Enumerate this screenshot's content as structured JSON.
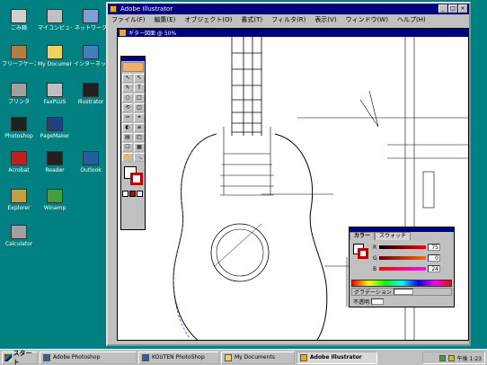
{
  "desktop": {
    "icons": [
      {
        "label": "ごみ箱",
        "icon": "recycle-bin-icon",
        "color": "#d0d0d0"
      },
      {
        "label": "マイコンピュータ",
        "icon": "my-computer-icon",
        "color": "#c0c0c0"
      },
      {
        "label": "ネットワーク",
        "icon": "network-icon",
        "color": "#7fa0d0"
      },
      {
        "label": "ブリーフケース",
        "icon": "briefcase-icon",
        "color": "#b08040"
      },
      {
        "label": "My Documents",
        "icon": "folder-icon",
        "color": "#f0d060"
      },
      {
        "label": "インターネット",
        "icon": "internet-icon",
        "color": "#4080c0"
      },
      {
        "label": "プリンタ",
        "icon": "printer-icon",
        "color": "#a0a0a0"
      },
      {
        "label": "FaxPLUS",
        "icon": "fax-icon",
        "color": "#c0c0c0"
      },
      {
        "label": "Illustrator",
        "icon": "illustrator-icon",
        "color": "#202020"
      },
      {
        "label": "Photoshop",
        "icon": "photoshop-icon",
        "color": "#202020"
      },
      {
        "label": "PageMaker",
        "icon": "pagemaker-icon",
        "color": "#204080"
      },
      {
        "label": "Acrobat",
        "icon": "acrobat-icon",
        "color": "#c02020"
      },
      {
        "label": "Reader",
        "icon": "reader-icon",
        "color": "#202020"
      },
      {
        "label": "Outlook",
        "icon": "outlook-icon",
        "color": "#2060a0"
      },
      {
        "label": "Explorer",
        "icon": "explorer-icon",
        "color": "#c0a040"
      },
      {
        "label": "Winamp",
        "icon": "winamp-icon",
        "color": "#40a040"
      },
      {
        "label": "Calculator",
        "icon": "calculator-icon",
        "color": "#a0a0a0"
      }
    ]
  },
  "app": {
    "title": "Adobe Illustrator",
    "menu": [
      "ファイル(F)",
      "編集(E)",
      "オブジェクト(O)",
      "書式(T)",
      "フィルタ(R)",
      "表示(V)",
      "ウィンドウ(W)",
      "ヘルプ(H)"
    ],
    "window_buttons": [
      "_",
      "□",
      "×"
    ]
  },
  "document": {
    "title": "ギター図面 @ 50%"
  },
  "tools": {
    "buttons": [
      "↖",
      "↖",
      "✎",
      "T",
      "○",
      "□",
      "⟲",
      "◫",
      "✂",
      "⌖",
      "◐",
      "≡",
      "▤",
      "◰",
      "☐",
      "▦",
      "✋",
      "🔍"
    ]
  },
  "color_palette": {
    "tab_color": "カラー",
    "tab_swatch": "スウォッチ",
    "channels": [
      {
        "name": "R",
        "value": "75",
        "gradient": "linear-gradient(to right,#000,#f00)"
      },
      {
        "name": "G",
        "value": "0",
        "gradient": "linear-gradient(to right,#600,#f60)"
      },
      {
        "name": "B",
        "value": "24",
        "gradient": "linear-gradient(to right,#f00,#f0f)"
      }
    ],
    "bottom_label": "グラデーション",
    "opacity_label": "不透明"
  },
  "taskbar": {
    "start_label": "スタート",
    "tasks": [
      {
        "label": "Adobe Photoshop",
        "icon": "photoshop-task-icon",
        "active": false
      },
      {
        "label": "KOUTEN PhotoShop",
        "icon": "photoshop-task-icon",
        "active": false
      },
      {
        "label": "My Documents",
        "icon": "folder-task-icon",
        "active": false
      },
      {
        "label": "Adobe Illustrator",
        "icon": "illustrator-task-icon",
        "active": true
      }
    ],
    "clock": "午後 1:23"
  },
  "colors": {
    "desktop": "#008080",
    "titlebar": "#000080",
    "stroke_red": "#c00000"
  }
}
